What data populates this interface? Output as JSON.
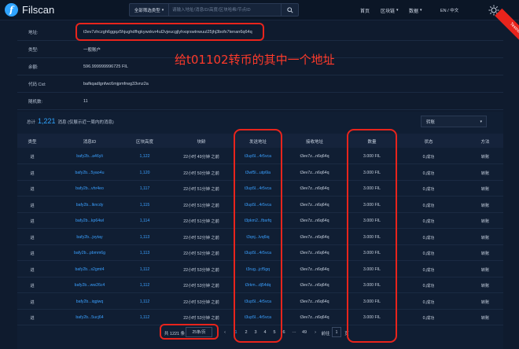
{
  "header": {
    "logo_letter": "f",
    "logo_text": "Filscan",
    "search_type": "全部筛选类型",
    "search_placeholder": "请输入地址/消息ID/高度/区块哈希/节点ID",
    "nav": [
      {
        "label": "首页",
        "dropdown": false
      },
      {
        "label": "区块链",
        "dropdown": true
      },
      {
        "label": "数据",
        "dropdown": true
      },
      {
        "label": "EN / 中文",
        "dropdown": false
      }
    ],
    "badge": "Testnet"
  },
  "info": {
    "rows": [
      {
        "label": "地址:",
        "value": "t3ev7zhczgh6ggqz5hjughdfhgkywxkvr4ul2vjeucgjlyhxqrswtnwuul25jhj3bofx7tenan6q64q"
      },
      {
        "label": "类型:",
        "value": "一般账户"
      },
      {
        "label": "余额:",
        "value": "596.999999996725 FIL"
      },
      {
        "label": "代码 Cid:",
        "value": "bafkqadlgnfwc6mjpmfrwg33vnz2a"
      },
      {
        "label": "随机数:",
        "value": "11"
      }
    ]
  },
  "annotation": {
    "text": "给t01102转币的其中一个地址"
  },
  "messages": {
    "total_prefix": "总计",
    "total_count": "1,221",
    "total_suffix": "消息 (仅展示近一周内的消息)",
    "filter": "转账",
    "columns": [
      "类型",
      "消息ID",
      "区块高度",
      "块龄",
      "发送地址",
      "接收地址",
      "数量",
      "状态",
      "方法"
    ],
    "rows": [
      {
        "type": "进",
        "id": "bafy2b...a46yli",
        "height": "1,122",
        "age": "22小时 49分钟 之前",
        "from": "t3up5l...4r5vca",
        "to": "t3ev7z...n6q64q",
        "value": "3.000 FIL",
        "status": "0,成功",
        "method": "转账"
      },
      {
        "type": "进",
        "id": "bafy2b...5yao4u",
        "height": "1,120",
        "age": "22小时 50分钟 之前",
        "from": "t3wf5l...utp6la",
        "to": "t3ev7z...n6q64q",
        "value": "3.000 FIL",
        "status": "0,成功",
        "method": "转账"
      },
      {
        "type": "进",
        "id": "bafy2b...vhr4eo",
        "height": "1,117",
        "age": "22小时 51分钟 之前",
        "from": "t3up5l...4r5vca",
        "to": "t3ev7z...n6q64q",
        "value": "3.000 FIL",
        "status": "0,成功",
        "method": "转账"
      },
      {
        "type": "进",
        "id": "bafy2b...lkncdy",
        "height": "1,115",
        "age": "22小时 51分钟 之前",
        "from": "t3up5l...4r5vca",
        "to": "t3ev7z...n6q64q",
        "value": "3.000 FIL",
        "status": "0,成功",
        "method": "转账"
      },
      {
        "type": "进",
        "id": "bafy2b...kp64wl",
        "height": "1,114",
        "age": "22小时 51分钟 之前",
        "from": "t3pkm2...fbsrfq",
        "to": "t3ev7z...n6q64q",
        "value": "3.000 FIL",
        "status": "0,成功",
        "method": "转账"
      },
      {
        "type": "进",
        "id": "bafy2b...jvytay",
        "height": "1,113",
        "age": "22小时 52分钟 之前",
        "from": "t3qnj...lvq6iq",
        "to": "t3ev7z...n6q64q",
        "value": "3.000 FIL",
        "status": "0,成功",
        "method": "转账"
      },
      {
        "type": "进",
        "id": "bafy2b...pbmm6g",
        "height": "1,113",
        "age": "22小时 52分钟 之前",
        "from": "t3up5l...4r5vca",
        "to": "t3ev7z...n6q64q",
        "value": "3.000 FIL",
        "status": "0,成功",
        "method": "转账"
      },
      {
        "type": "进",
        "id": "bafy2b...s2gmt4",
        "height": "1,112",
        "age": "22小时 53分钟 之前",
        "from": "t3rug...jcf5gq",
        "to": "t3ev7z...n6q64q",
        "value": "3.000 FIL",
        "status": "0,成功",
        "method": "转账"
      },
      {
        "type": "进",
        "id": "bafy2b...ww26c4",
        "height": "1,112",
        "age": "22小时 53分钟 之前",
        "from": "t3rkm...dj54dq",
        "to": "t3ev7z...n6q64q",
        "value": "3.000 FIL",
        "status": "0,成功",
        "method": "转账"
      },
      {
        "type": "进",
        "id": "bafy2b...iqgiwq",
        "height": "1,112",
        "age": "22小时 53分钟 之前",
        "from": "t3up5l...4r5vca",
        "to": "t3ev7z...n6q64q",
        "value": "3.000 FIL",
        "status": "0,成功",
        "method": "转账"
      },
      {
        "type": "进",
        "id": "bafy2b...5ucj64",
        "height": "1,112",
        "age": "22小时 53分钟 之前",
        "from": "t3up5l...4r5vca",
        "to": "t3ev7z...n6q64q",
        "value": "3.000 FIL",
        "status": "0,成功",
        "method": "转账"
      }
    ]
  },
  "pager": {
    "total": "共 1221 条",
    "page_size": "25条/页",
    "prev": "‹",
    "pages": [
      "1",
      "2",
      "3",
      "4",
      "5",
      "6"
    ],
    "ellipsis": "···",
    "last": "49",
    "next": "›",
    "goto_prefix": "前往",
    "goto_value": "1",
    "goto_suffix": "页"
  }
}
